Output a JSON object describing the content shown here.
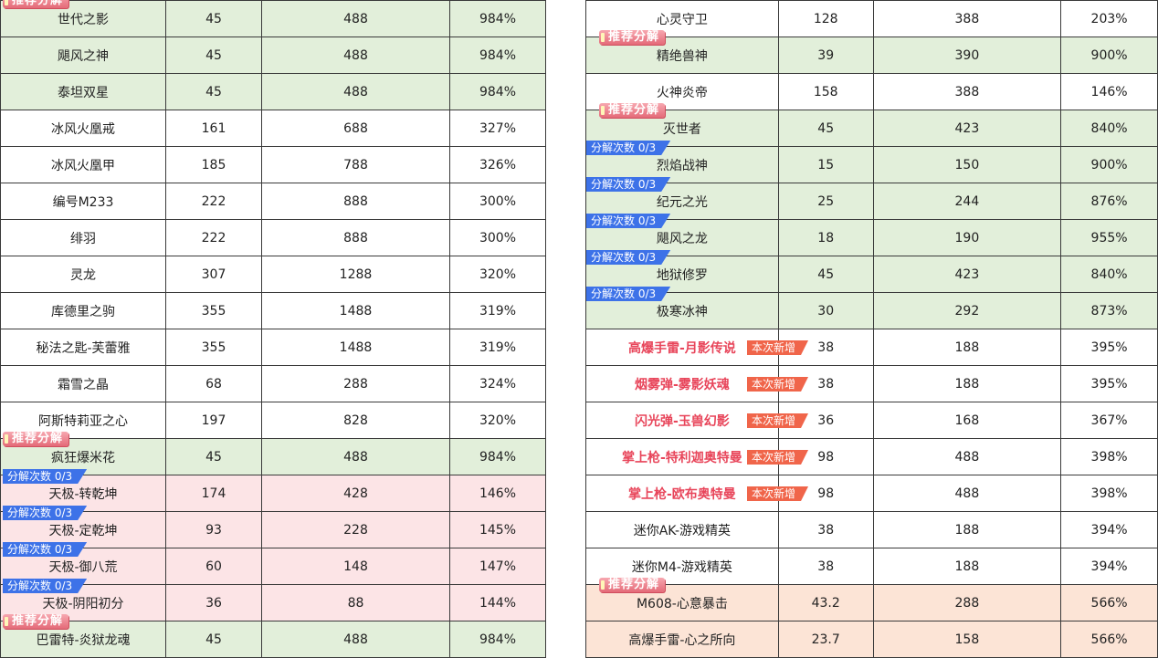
{
  "tags": {
    "recommend": "推荐分解",
    "decompose": "分解次数 0/3",
    "new_item": "本次新增"
  },
  "left_rows": [
    {
      "name": "世代之影",
      "a": "45",
      "b": "488",
      "c": "984%",
      "bg": "g",
      "tag": "recommend"
    },
    {
      "name": "飓风之神",
      "a": "45",
      "b": "488",
      "c": "984%",
      "bg": "g",
      "tag": ""
    },
    {
      "name": "泰坦双星",
      "a": "45",
      "b": "488",
      "c": "984%",
      "bg": "g",
      "tag": ""
    },
    {
      "name": "冰风火凰戒",
      "a": "161",
      "b": "688",
      "c": "327%",
      "bg": "w",
      "tag": ""
    },
    {
      "name": "冰风火凰甲",
      "a": "185",
      "b": "788",
      "c": "326%",
      "bg": "w",
      "tag": ""
    },
    {
      "name": "编号M233",
      "a": "222",
      "b": "888",
      "c": "300%",
      "bg": "w",
      "tag": ""
    },
    {
      "name": "绯羽",
      "a": "222",
      "b": "888",
      "c": "300%",
      "bg": "w",
      "tag": ""
    },
    {
      "name": "灵龙",
      "a": "307",
      "b": "1288",
      "c": "320%",
      "bg": "w",
      "tag": ""
    },
    {
      "name": "库德里之驹",
      "a": "355",
      "b": "1488",
      "c": "319%",
      "bg": "w",
      "tag": ""
    },
    {
      "name": "秘法之匙-芙蕾雅",
      "a": "355",
      "b": "1488",
      "c": "319%",
      "bg": "w",
      "tag": ""
    },
    {
      "name": "霜雪之晶",
      "a": "68",
      "b": "288",
      "c": "324%",
      "bg": "w",
      "tag": ""
    },
    {
      "name": "阿斯特莉亚之心",
      "a": "197",
      "b": "828",
      "c": "320%",
      "bg": "w",
      "tag": ""
    },
    {
      "name": "疯狂爆米花",
      "a": "45",
      "b": "488",
      "c": "984%",
      "bg": "g",
      "tag": "recommend"
    },
    {
      "name": "天极-转乾坤",
      "a": "174",
      "b": "428",
      "c": "146%",
      "bg": "p",
      "tag": "decompose"
    },
    {
      "name": "天极-定乾坤",
      "a": "93",
      "b": "228",
      "c": "145%",
      "bg": "p",
      "tag": "decompose"
    },
    {
      "name": "天极-御八荒",
      "a": "60",
      "b": "148",
      "c": "147%",
      "bg": "p",
      "tag": "decompose"
    },
    {
      "name": "天极-阴阳初分",
      "a": "36",
      "b": "88",
      "c": "144%",
      "bg": "p",
      "tag": "decompose"
    },
    {
      "name": "巴雷特-炎狱龙魂",
      "a": "45",
      "b": "488",
      "c": "984%",
      "bg": "g",
      "tag": "recommend"
    }
  ],
  "right_rows": [
    {
      "name": "心灵守卫",
      "a": "128",
      "b": "388",
      "c": "203%",
      "bg": "w",
      "tag": ""
    },
    {
      "name": "精绝兽神",
      "a": "39",
      "b": "390",
      "c": "900%",
      "bg": "g",
      "tag": "recommend"
    },
    {
      "name": "火神炎帝",
      "a": "158",
      "b": "388",
      "c": "146%",
      "bg": "w",
      "tag": ""
    },
    {
      "name": "灭世者",
      "a": "45",
      "b": "423",
      "c": "840%",
      "bg": "g",
      "tag": "recommend"
    },
    {
      "name": "烈焰战神",
      "a": "15",
      "b": "150",
      "c": "900%",
      "bg": "g",
      "tag": "decompose"
    },
    {
      "name": "纪元之光",
      "a": "25",
      "b": "244",
      "c": "876%",
      "bg": "g",
      "tag": "decompose"
    },
    {
      "name": "飓风之龙",
      "a": "18",
      "b": "190",
      "c": "955%",
      "bg": "g",
      "tag": "decompose"
    },
    {
      "name": "地狱修罗",
      "a": "45",
      "b": "423",
      "c": "840%",
      "bg": "g",
      "tag": "decompose"
    },
    {
      "name": "极寒冰神",
      "a": "30",
      "b": "292",
      "c": "873%",
      "bg": "g",
      "tag": "decompose"
    },
    {
      "name": "高爆手雷-月影传说",
      "a": "38",
      "b": "188",
      "c": "395%",
      "bg": "w",
      "tag": "new",
      "red": true
    },
    {
      "name": "烟雾弹-雾影妖魂",
      "a": "38",
      "b": "188",
      "c": "395%",
      "bg": "w",
      "tag": "new",
      "red": true
    },
    {
      "name": "闪光弹-玉兽幻影",
      "a": "36",
      "b": "168",
      "c": "367%",
      "bg": "w",
      "tag": "new",
      "red": true
    },
    {
      "name": "掌上枪-特利迦奥特曼",
      "a": "98",
      "b": "488",
      "c": "398%",
      "bg": "w",
      "tag": "new",
      "red": true
    },
    {
      "name": "掌上枪-欧布奥特曼",
      "a": "98",
      "b": "488",
      "c": "398%",
      "bg": "w",
      "tag": "new",
      "red": true
    },
    {
      "name": "迷你AK-游戏精英",
      "a": "38",
      "b": "188",
      "c": "394%",
      "bg": "w",
      "tag": ""
    },
    {
      "name": "迷你M4-游戏精英",
      "a": "38",
      "b": "188",
      "c": "394%",
      "bg": "w",
      "tag": ""
    },
    {
      "name": "M608-心意暴击",
      "a": "43.2",
      "b": "288",
      "c": "566%",
      "bg": "o",
      "tag": "recommend"
    },
    {
      "name": "高爆手雷-心之所向",
      "a": "23.7",
      "b": "158",
      "c": "566%",
      "bg": "o",
      "tag": ""
    }
  ]
}
